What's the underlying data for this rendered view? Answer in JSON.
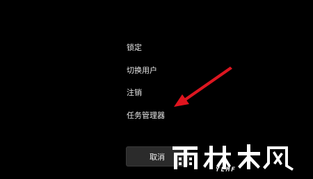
{
  "menu": {
    "items": [
      {
        "label": "锁定"
      },
      {
        "label": "切换用户"
      },
      {
        "label": "注销"
      },
      {
        "label": "任务管理器"
      }
    ]
  },
  "cancel_button": {
    "label": "取消"
  },
  "watermark": {
    "title": "雨林木风",
    "subtitle": "YLMF"
  },
  "colors": {
    "background": "#000000",
    "text": "#e8e8e8",
    "button_bg": "#2b2b2b",
    "arrow": "#e0141e"
  }
}
